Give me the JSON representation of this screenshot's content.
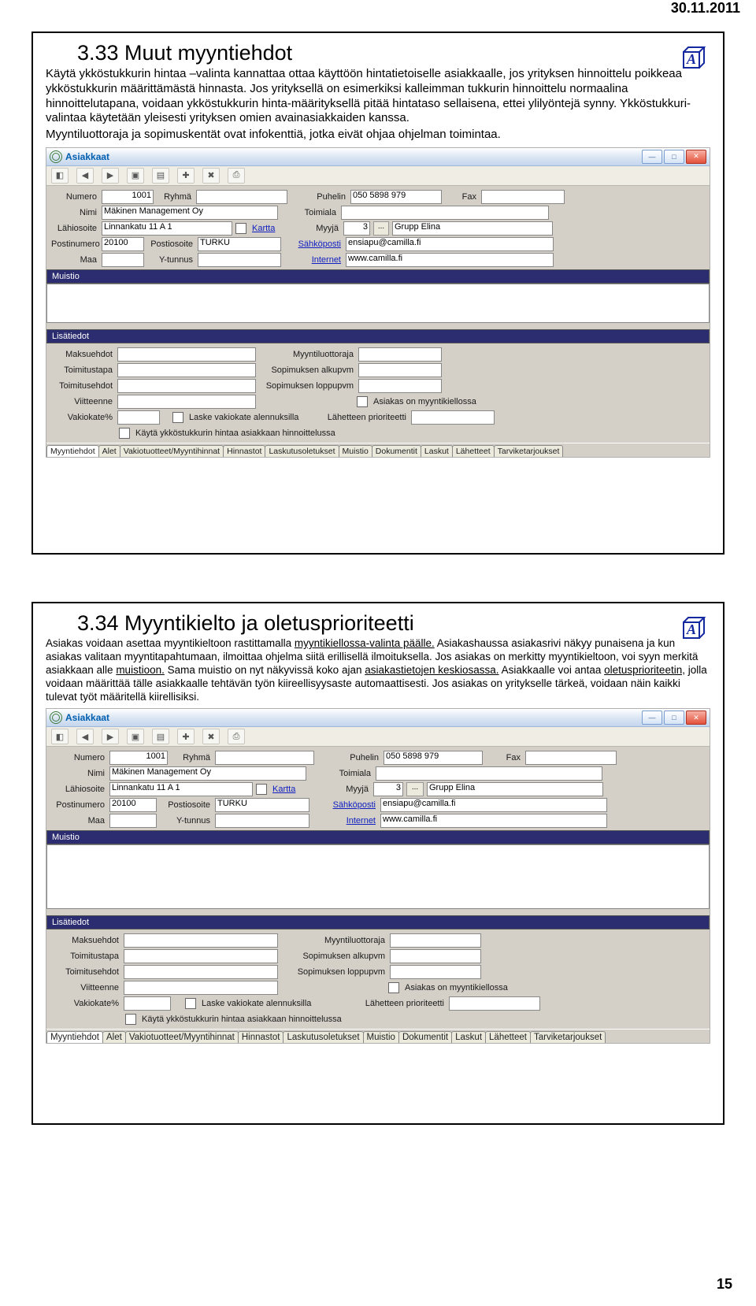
{
  "page": {
    "date": "30.11.2011",
    "number": "15"
  },
  "logo_letter": "A",
  "slide1": {
    "title": "3.33 Muut myyntiehdot",
    "para": "Käytä ykköstukkurin hintaa –valinta kannattaa ottaa käyttöön hintatietoiselle asiakkaalle, jos yrityksen hinnoittelu poikkeaa ykköstukkurin määrittämästä hinnasta. Jos yrityksellä on esimerkiksi kalleimman tukkurin hinnoittelu normaalina hinnoittelutapana, voidaan ykköstukkurin hinta-määrityksellä pitää hintataso sellaisena, ettei ylilyöntejä synny. Ykköstukkuri-valintaa käytetään yleisesti yrityksen omien avainasiakkaiden kanssa.",
    "para2": "Myyntiluottoraja ja sopimuskentät ovat infokenttiä, jotka eivät ohjaa ohjelman toimintaa."
  },
  "slide2": {
    "title": "3.34 Myyntikielto ja oletusprioriteetti",
    "para": "Asiakas voidaan asettaa myyntikieltoon rastittamalla myyntikiellossa-valinta päälle. Asiakashaussa asiakasrivi näkyy punaisena ja kun asiakas valitaan myyntitapahtumaan, ilmoittaa ohjelma siitä erillisellä ilmoituksella. Jos asiakas on merkitty myyntikieltoon, voi syyn merkitä asiakkaan alle muistioon. Sama muistio on nyt näkyvissä koko ajan asiakastietojen keskiosassa. Asiakkaalle voi antaa oletusprioriteetin, jolla voidaan määrittää tälle asiakkaalle tehtävän työn kiireellisyysaste automaattisesti. Jos asiakas on yritykselle tärkeä, voidaan näin kaikki tulevat työt määritellä kiirellisiksi.",
    "underlines": {
      "u1": "myyntikiellossa-valinta päälle.",
      "u2": "muistioon.",
      "u3": "asiakastietojen keskiosassa.",
      "u4": "oletusprioriteetin,"
    }
  },
  "shot": {
    "window_title": "Asiakkaat",
    "labels": {
      "numero": "Numero",
      "ryhma": "Ryhmä",
      "puhelin": "Puhelin",
      "fax": "Fax",
      "nimi": "Nimi",
      "toimiala": "Toimiala",
      "lahiosoite": "Lähiosoite",
      "kartta": "Kartta",
      "myyja": "Myyjä",
      "postinumero": "Postinumero",
      "postiosoite": "Postiosoite",
      "sahkoposti": "Sähköposti",
      "maa": "Maa",
      "ytunnus": "Y-tunnus",
      "internet": "Internet",
      "muistio": "Muistio",
      "lisatiedot": "Lisätiedot",
      "maksuehdot": "Maksuehdot",
      "myyntiluottoraja": "Myyntiluottoraja",
      "toimitustapa": "Toimitustapa",
      "sop_alku": "Sopimuksen alkupvm",
      "toimitusehdot": "Toimitusehdot",
      "sop_loppu": "Sopimuksen loppupvm",
      "viitteenne": "Viitteenne",
      "asiakas_kiellossa": "Asiakas on myyntikiellossa",
      "vakiokate": "Vakiokate%",
      "laske_vakio": "Laske vakiokate alennuksilla",
      "lahetteen_prio": "Lähetteen prioriteetti",
      "kayta_ykkos": "Käytä ykköstukkurin hintaa asiakkaan hinnoittelussa"
    },
    "values": {
      "numero": "1001",
      "puhelin": "050 5898 979",
      "nimi": "Mäkinen Management Oy",
      "lahiosoite": "Linnankatu 11 A 1",
      "myyja_num": "3",
      "myyja_name": "Grupp Elina",
      "postinumero": "20100",
      "postiosoite": "TURKU",
      "sahkoposti": "ensiapu@camilla.fi",
      "internet": "www.camilla.fi"
    },
    "tabs": [
      "Myyntiehdot",
      "Alet",
      "Vakiotuotteet/Myyntihinnat",
      "Hinnastot",
      "Laskutusoletukset",
      "Muistio",
      "Dokumentit",
      "Laskut",
      "Lähetteet",
      "Tarviketarjoukset"
    ]
  }
}
